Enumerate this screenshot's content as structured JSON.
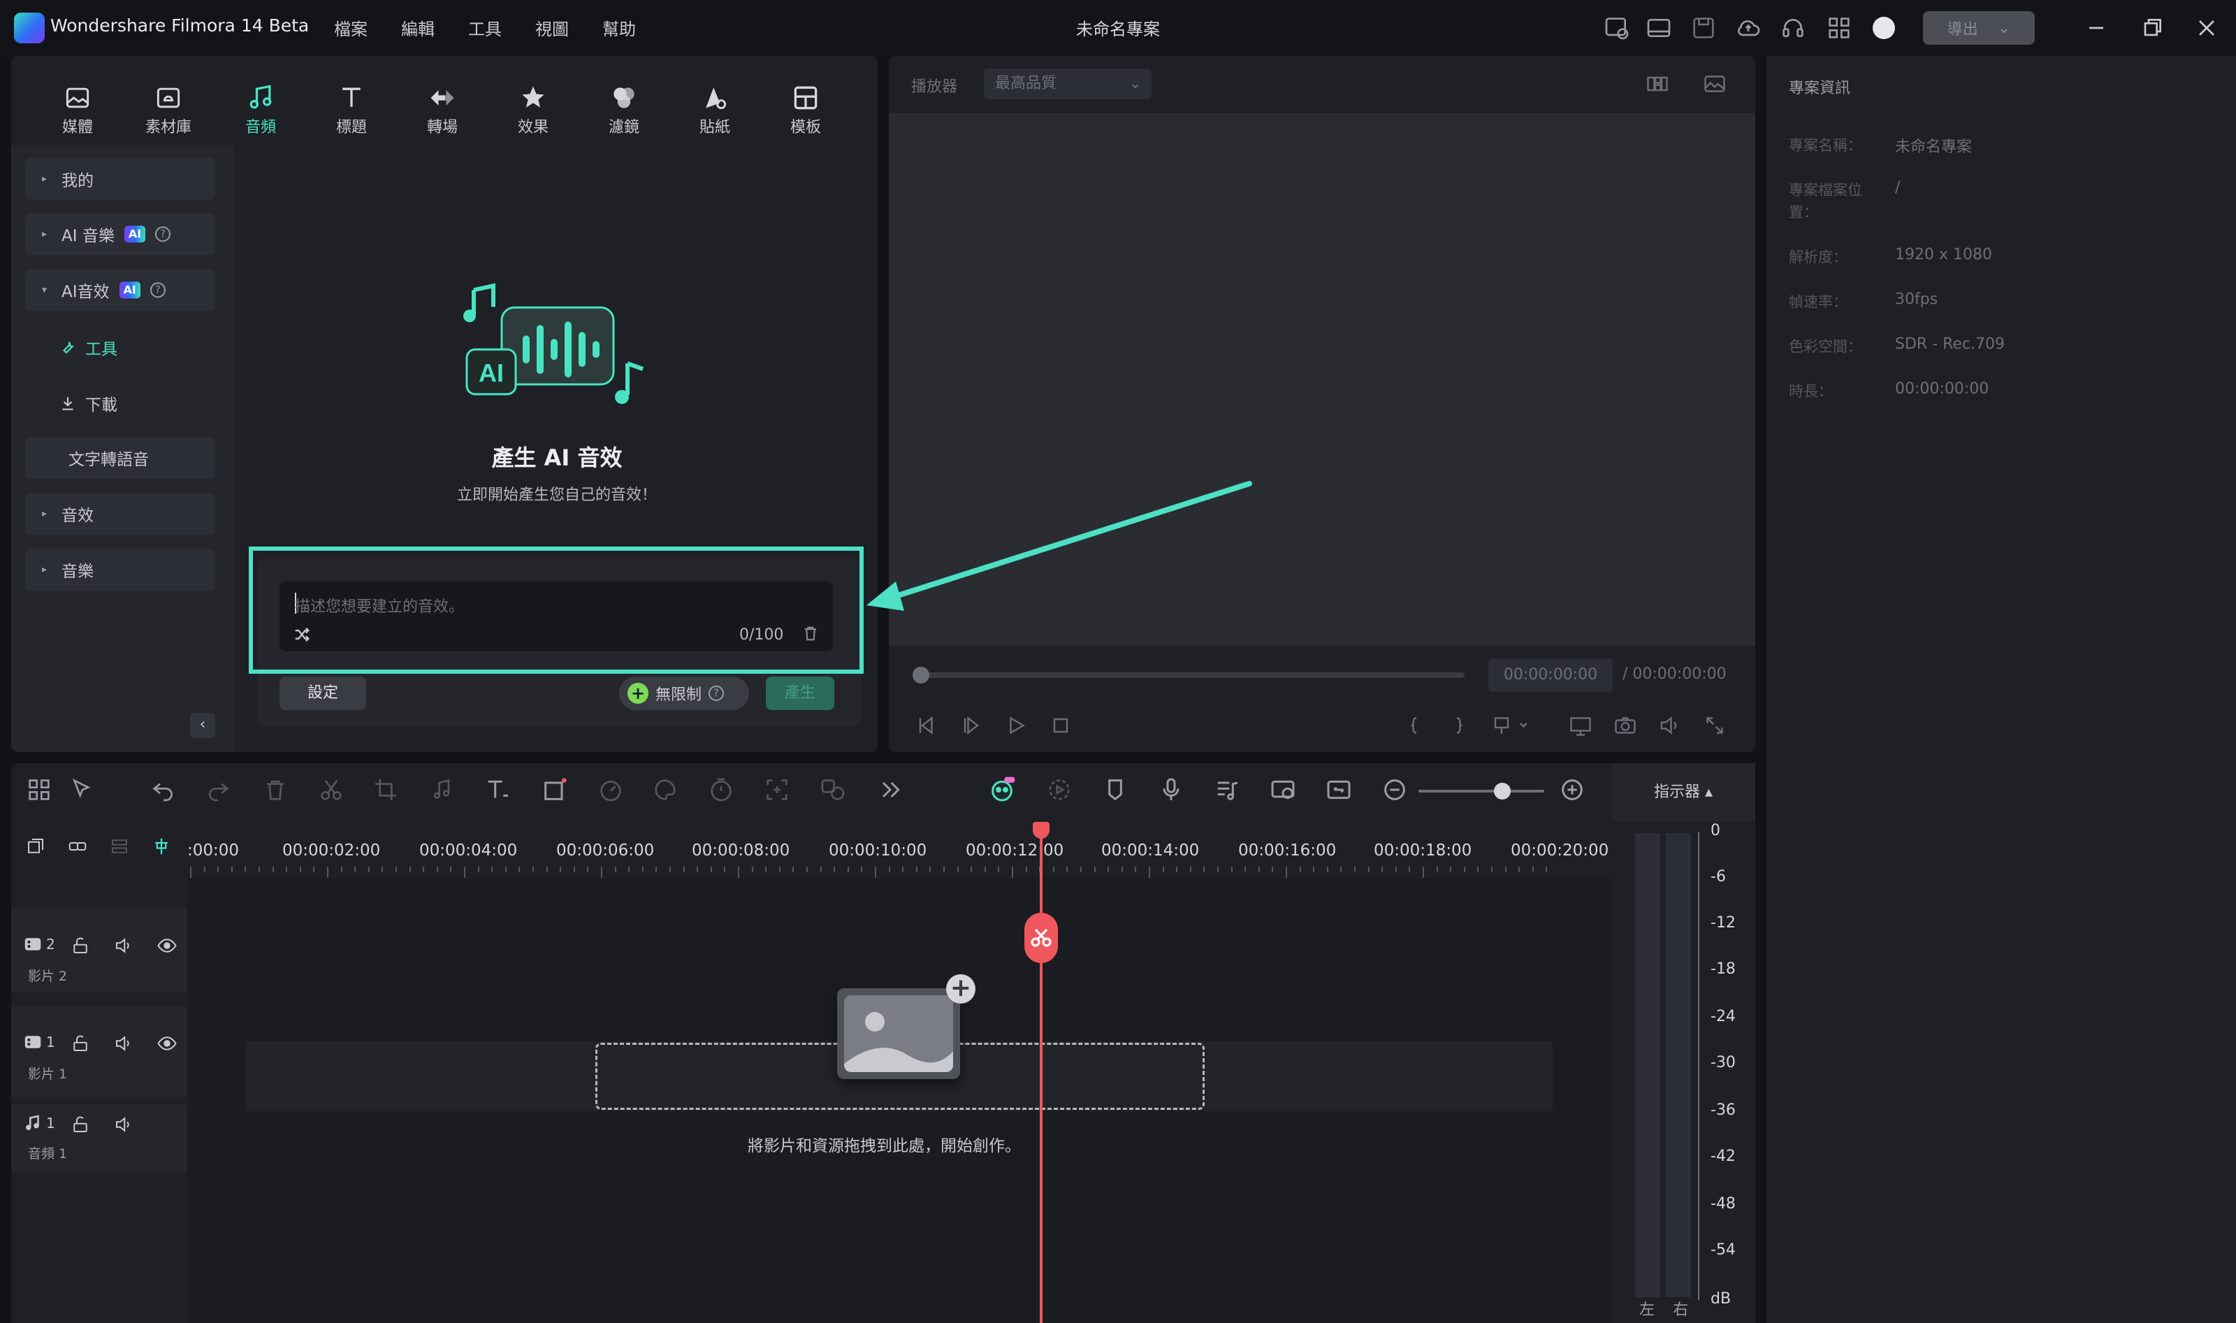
{
  "app": {
    "title": "Wondershare Filmora 14 Beta",
    "project_title": "未命名專案",
    "menus": [
      "檔案",
      "編輯",
      "工具",
      "視圖",
      "幫助"
    ],
    "export_label": "導出"
  },
  "categories": [
    {
      "label": "媒體",
      "icon": "media-icon"
    },
    {
      "label": "素材庫",
      "icon": "stock-library-icon"
    },
    {
      "label": "音頻",
      "icon": "audio-note-icon",
      "active": true
    },
    {
      "label": "標題",
      "icon": "title-text-icon"
    },
    {
      "label": "轉場",
      "icon": "transition-icon"
    },
    {
      "label": "效果",
      "icon": "effects-star-icon"
    },
    {
      "label": "濾鏡",
      "icon": "filter-icon"
    },
    {
      "label": "貼紙",
      "icon": "sticker-icon"
    },
    {
      "label": "模板",
      "icon": "template-icon"
    }
  ],
  "sidebar": {
    "mine": "我的",
    "ai_music": "AI 音樂",
    "ai_sfx": "AI音效",
    "ai_badge": "AI",
    "tools": "工具",
    "download": "下載",
    "tts": "文字轉語音",
    "sfx": "音效",
    "music": "音樂"
  },
  "hero": {
    "title": "產生 AI 音效",
    "subtitle": "立即開始產生您自己的音效！"
  },
  "prompt": {
    "placeholder": "描述您想要建立的音效。",
    "count": "0/100",
    "settings_label": "設定",
    "unlimited_label": "無限制",
    "generate_label": "產生"
  },
  "player": {
    "label": "播放器",
    "quality": "最高品質",
    "time_current": "00:00:00:00",
    "time_total": "/ 00:00:00:00"
  },
  "info": {
    "heading": "專案資訊",
    "rows": [
      {
        "k": "專案名稱：",
        "v": "未命名專案"
      },
      {
        "k": "專案檔案位置：",
        "v": "/"
      },
      {
        "k": "解析度：",
        "v": "1920 x 1080"
      },
      {
        "k": "幀速率：",
        "v": "30fps"
      },
      {
        "k": "色彩空間：",
        "v": "SDR - Rec.709"
      },
      {
        "k": "時長：",
        "v": "00:00:00:00"
      }
    ]
  },
  "timeline": {
    "meter_label": "指示器 ▴",
    "ticks": [
      ":00:00",
      "00:00:02:00",
      "00:00:04:00",
      "00:00:06:00",
      "00:00:08:00",
      "00:00:10:00",
      "00:00:12:00",
      "00:00:14:00",
      "00:00:16:00",
      "00:00:18:00",
      "00:00:20:00"
    ],
    "tracks": [
      {
        "num": "2",
        "name": "影片 2"
      },
      {
        "num": "1",
        "name": "影片 1"
      },
      {
        "num": "1",
        "name": "音頻 1"
      }
    ],
    "drop_text": "將影片和資源拖拽到此處，開始創作。",
    "db_scale": [
      "0",
      "-6",
      "-12",
      "-18",
      "-24",
      "-30",
      "-36",
      "-42",
      "-48",
      "-54",
      "dB"
    ],
    "left": "左",
    "right": "右"
  },
  "colors": {
    "accent": "#48e3c3",
    "highlight": "#4de0c4",
    "playhead": "#f0575c"
  }
}
